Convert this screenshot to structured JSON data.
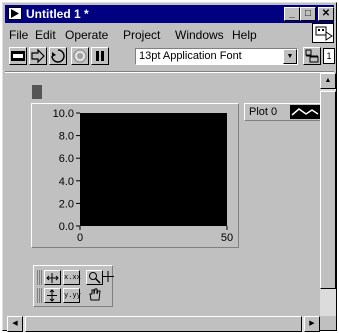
{
  "window": {
    "title": "Untitled 1 *",
    "controls": {
      "minimize": "_",
      "maximize": "□",
      "close": "✕"
    }
  },
  "menu": {
    "items": [
      {
        "label": "File"
      },
      {
        "label": "Edit"
      },
      {
        "label": "Operate"
      },
      {
        "label": "Project"
      },
      {
        "label": "Windows"
      },
      {
        "label": "Help"
      }
    ]
  },
  "toolbar": {
    "font_select": {
      "value": "13pt Application Font"
    },
    "icons": [
      "run-arrow-icon",
      "run-continuous-icon",
      "abort-icon",
      "pause-icon",
      "text-settings",
      "align-objects",
      "connector-pane",
      "vi-icon"
    ]
  },
  "graph": {
    "legend": {
      "plot_label": "Plot 0"
    },
    "palette": {
      "x_format": "x.xx",
      "y_format": "y.yy",
      "x_scale_icon": "x-scale-lock-icon",
      "y_scale_icon": "y-scale-lock-icon",
      "zoom_icon": "zoom-icon",
      "cursor_icon": "crosshair-icon",
      "pan_icon": "hand-pan-icon"
    },
    "colors": {
      "plot_bg": "#000000",
      "panel_bg": "#c0c0c0"
    }
  },
  "chart_data": {
    "type": "line",
    "title": "",
    "xlabel": "",
    "ylabel": "",
    "x_ticks": [
      "0",
      "50"
    ],
    "y_ticks": [
      "10.0",
      "8.0",
      "6.0",
      "4.0",
      "2.0",
      "0.0"
    ],
    "xlim": [
      0,
      50
    ],
    "ylim": [
      0,
      10
    ],
    "series": [
      {
        "name": "Plot 0",
        "x": [],
        "y": []
      }
    ],
    "grid": false,
    "legend_position": "top-right"
  }
}
